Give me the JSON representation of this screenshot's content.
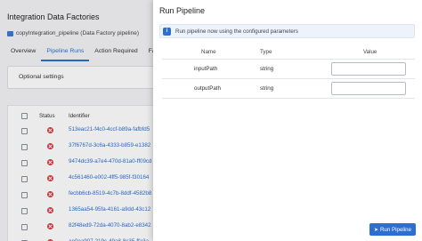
{
  "background": {
    "title": "Integration Data Factories",
    "subtitle": "copyIntegration_pipeline (Data Factory pipeline)",
    "tabs": [
      "Overview",
      "Pipeline Runs",
      "Action Required",
      "Favo"
    ],
    "active_tab": "Pipeline Runs",
    "optional_settings_label": "Optional settings",
    "table": {
      "headers": [
        "Status",
        "Identifier"
      ],
      "rows": [
        "513eac21-f4c0-4ccf-b89a-fafbfd5",
        "37f6767d-3c6a-4333-b859-e1382",
        "9474dc39-a7e4-470d-81a0-ff09cd",
        "4c561460-e002-4ff5-985f-f30164",
        "fecbb6cb-8519-4c7b-8ddf-4582b8",
        "1365aa54-95fa-4161-a9dd-43c12",
        "82f48ed9-72da-4070-8ab2-e8342",
        "ae0ea907-219c-49a8-8c35-ffa3a"
      ]
    }
  },
  "drawer": {
    "title": "Run Pipeline",
    "info_text": "Run pipeline now using the configured parameters",
    "param_headers": {
      "name": "Name",
      "type": "Type",
      "value": "Value"
    },
    "params": [
      {
        "name": "inputPath",
        "type": "string",
        "value": ""
      },
      {
        "name": "outputPath",
        "type": "string",
        "value": ""
      }
    ],
    "run_button_label": "Run Pipeline"
  },
  "colors": {
    "accent": "#2d6fd1",
    "error": "#d9363e"
  }
}
